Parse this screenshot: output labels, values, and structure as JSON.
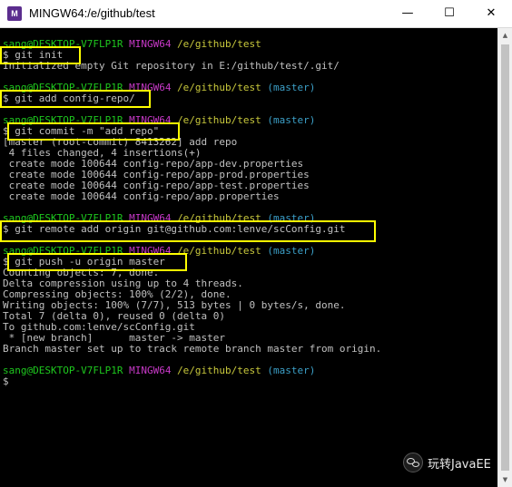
{
  "window": {
    "title": "MINGW64:/e/github/test",
    "app_icon_label": "M",
    "minimize_glyph": "—",
    "maximize_glyph": "☐",
    "close_glyph": "✕"
  },
  "prompt": {
    "user": "sang@DESKTOP-V7FLP1R",
    "shell": "MINGW64",
    "path": "/e/github/test",
    "branch": "(master)"
  },
  "lines": {
    "l1": "$ git init",
    "l2": "Initialized empty Git repository in E:/github/test/.git/",
    "l3": "$ git add config-repo/",
    "l4": "$ git commit -m \"add repo\"",
    "l5": "[master (root-commit) 8413262] add repo",
    "l6": " 4 files changed, 4 insertions(+)",
    "l7": " create mode 100644 config-repo/app-dev.properties",
    "l8": " create mode 100644 config-repo/app-prod.properties",
    "l9": " create mode 100644 config-repo/app-test.properties",
    "l10": " create mode 100644 config-repo/app.properties",
    "l11": "$ git remote add origin git@github.com:lenve/scConfig.git",
    "l12": "$ git push -u origin master",
    "l13": "Counting objects: 7, done.",
    "l14": "Delta compression using up to 4 threads.",
    "l15": "Compressing objects: 100% (2/2), done.",
    "l16": "Writing objects: 100% (7/7), 513 bytes | 0 bytes/s, done.",
    "l17": "Total 7 (delta 0), reused 0 (delta 0)",
    "l18": "To github.com:lenve/scConfig.git",
    "l19": " * [new branch]      master -> master",
    "l20": "Branch master set up to track remote branch master from origin.",
    "l21": "$"
  },
  "watermark": {
    "text": "玩转JavaEE"
  },
  "colors": {
    "user": "#1ec81e",
    "shell": "#c839c8",
    "path": "#c8c83c",
    "branch": "#3ca0c8",
    "text": "#c0c0c0",
    "highlight": "#ffff00",
    "background": "#000000"
  }
}
